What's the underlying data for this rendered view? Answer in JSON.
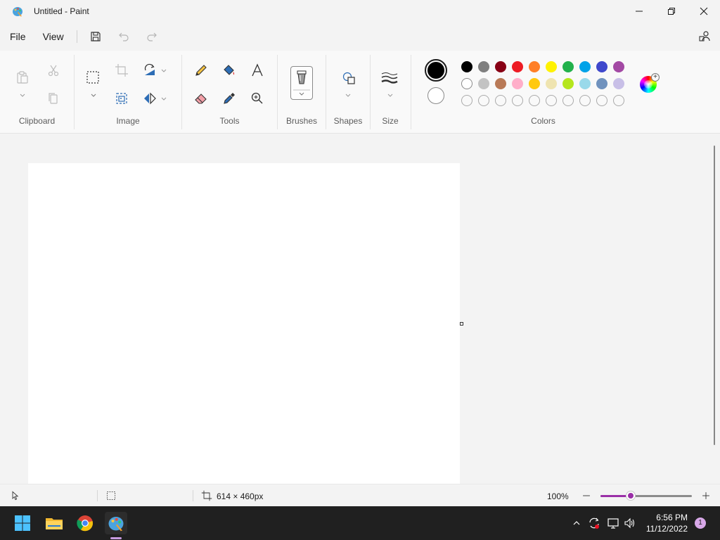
{
  "window": {
    "title": "Untitled - Paint",
    "app_icon": "paint-palette-icon"
  },
  "menu": {
    "file": "File",
    "view": "View"
  },
  "ribbon": {
    "groups": {
      "clipboard": "Clipboard",
      "image": "Image",
      "tools": "Tools",
      "brushes": "Brushes",
      "shapes": "Shapes",
      "size": "Size",
      "colors": "Colors"
    },
    "colors": {
      "primary": "#000000",
      "secondary": "#ffffff",
      "row1": [
        "#000000",
        "#7f7f7f",
        "#880015",
        "#ed1c24",
        "#ff7f27",
        "#fff200",
        "#22b14c",
        "#00a2e8",
        "#3f48cc",
        "#a349a4"
      ],
      "row2": [
        "#ffffff",
        "#c3c3c3",
        "#b97a57",
        "#ffaec9",
        "#ffc90e",
        "#efe4b0",
        "#b5e61d",
        "#99d9ea",
        "#7092be",
        "#c8bfe7"
      ],
      "row3_empty_count": 10
    }
  },
  "status": {
    "canvas_size": "614 × 460px",
    "zoom": "100%",
    "zoom_level": 0.33
  },
  "taskbar": {
    "time": "6:56 PM",
    "date": "11/12/2022",
    "notifications": "1",
    "accent": "#9a2fa7"
  }
}
